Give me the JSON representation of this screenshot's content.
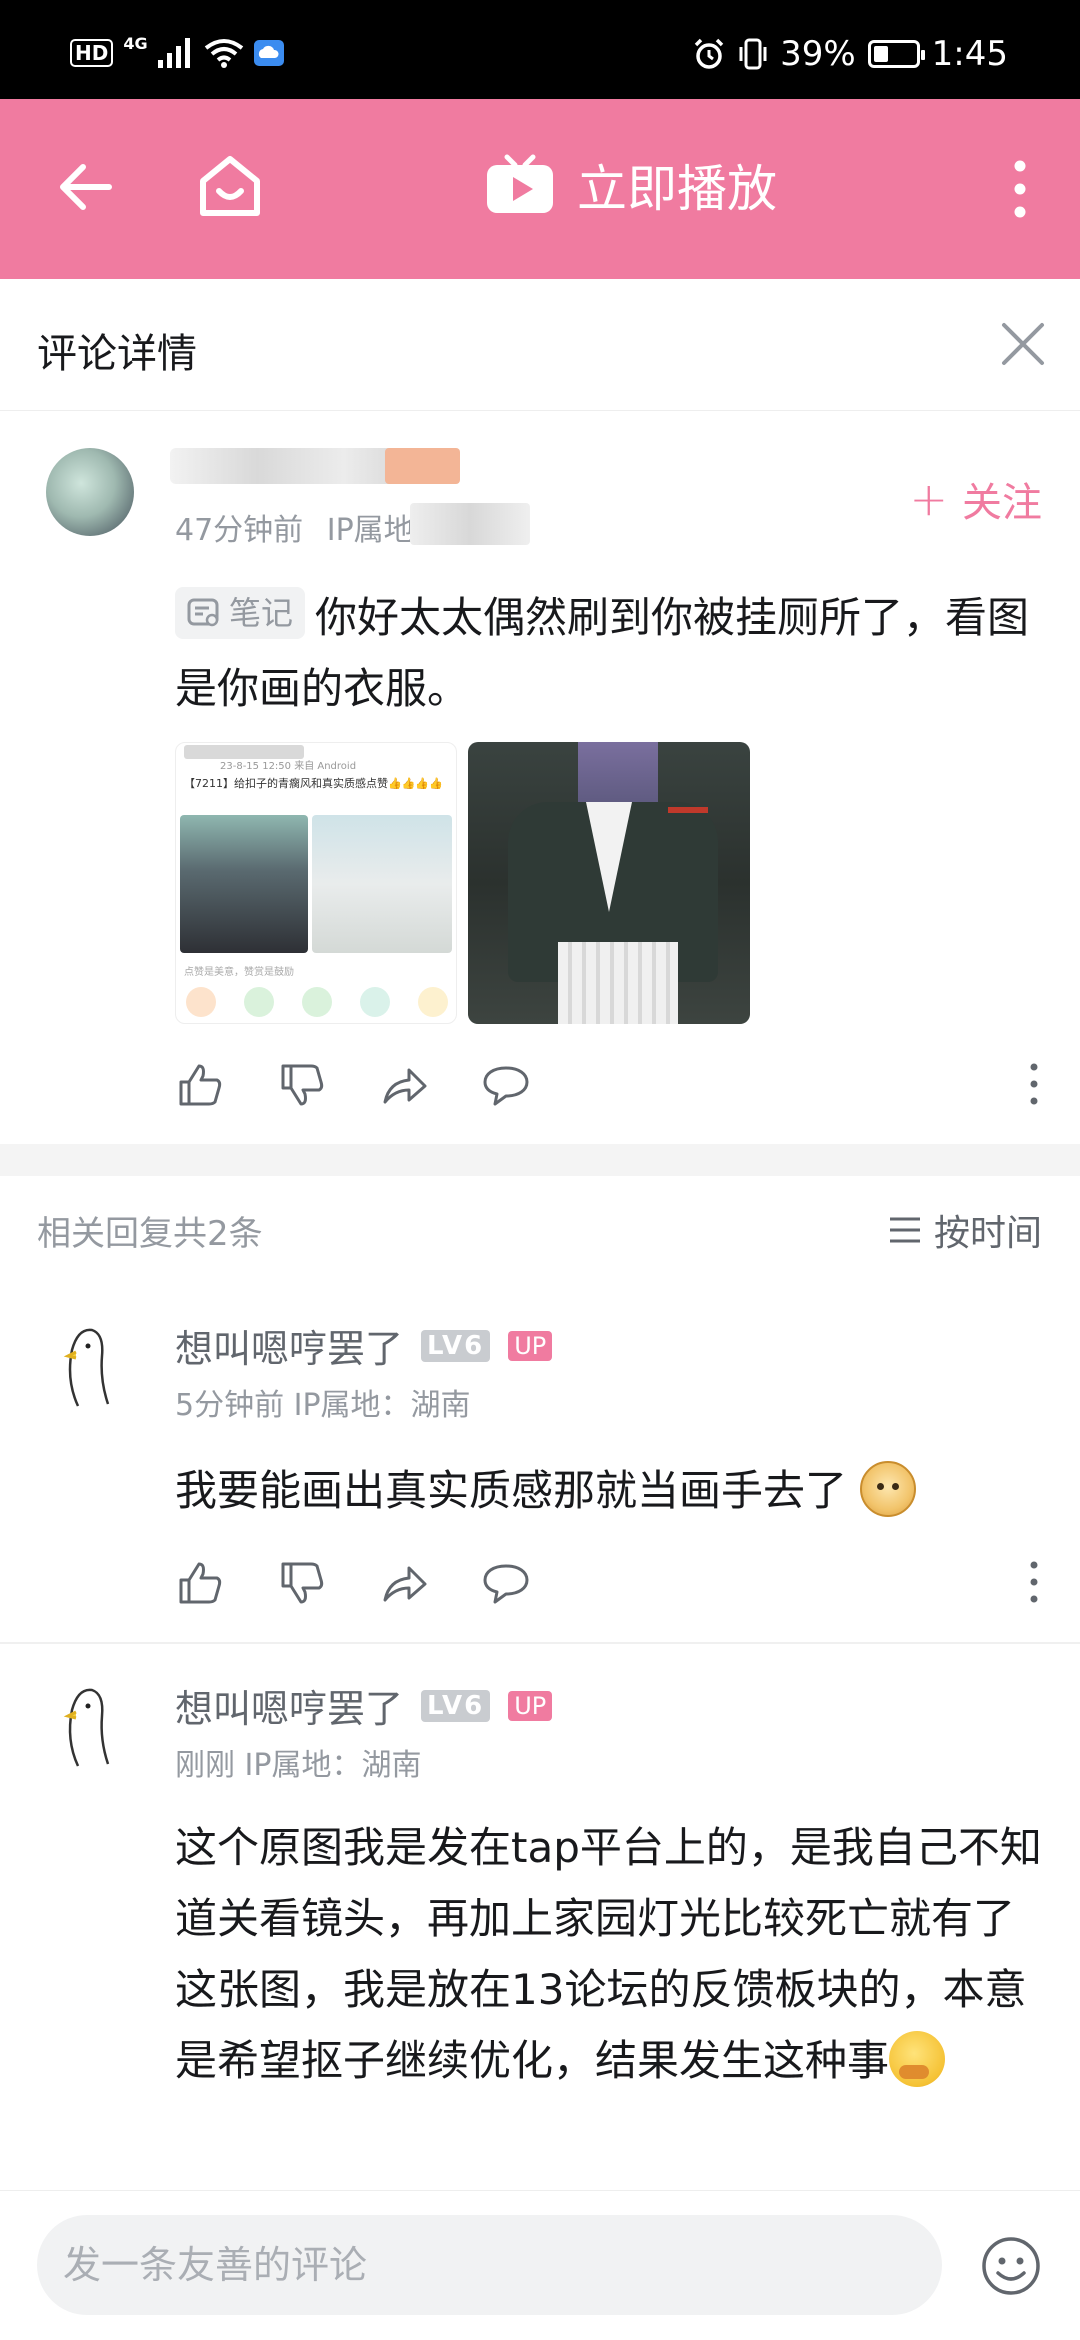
{
  "status_bar": {
    "hd": "HD",
    "network": "4G",
    "battery": "39%",
    "time": "1:45"
  },
  "app_bar": {
    "play_label": "立即播放"
  },
  "panel": {
    "title": "评论详情"
  },
  "main_comment": {
    "time": "47分钟前",
    "ip_label": "IP属地",
    "follow_label": "关注",
    "note_tag": "笔记",
    "text": "你好太太偶然刷到你被挂厕所了，看图是你画的衣服。",
    "image1": {
      "date_line": "23-8-15 12:50  来自 Android",
      "post_title": "【7211】给扣子的青瘸风和真实质感点赞👍👍👍👍",
      "caption": "点赞是美意，赞赏是鼓励"
    }
  },
  "replies_header": {
    "count_label": "相关回复共2条",
    "sort_label": "按时间"
  },
  "replies": [
    {
      "username": "想叫嗯哼罢了",
      "level": "LV6",
      "up_badge": "UP",
      "meta": "5分钟前  IP属地：湖南",
      "text": "我要能画出真实质感那就当画手去了"
    },
    {
      "username": "想叫嗯哼罢了",
      "level": "LV6",
      "up_badge": "UP",
      "meta": "刚刚  IP属地：湖南",
      "text": "这个原图我是发在tap平台上的，是我自己不知道关看镜头，再加上家园灯光比较死亡就有了这张图，我是放在13论坛的反馈板块的，本意是希望抠子继续优化，结果发生这种事"
    }
  ],
  "composer": {
    "placeholder": "发一条友善的评论"
  },
  "colors": {
    "accent": "#f07ba0",
    "muted": "#9499a0"
  }
}
